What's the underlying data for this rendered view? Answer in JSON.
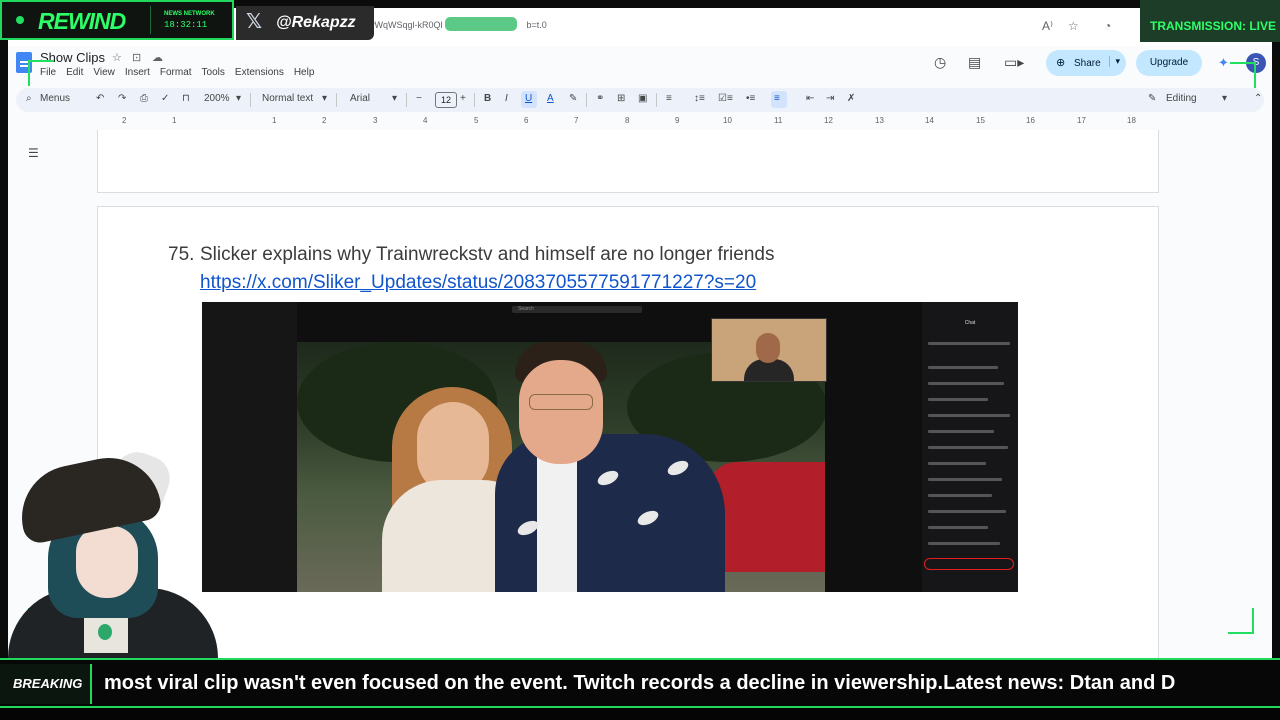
{
  "browser": {
    "url_fragment": "vWqWSqgl-kR0Ql",
    "url_suffix": "b=t.0"
  },
  "docs": {
    "title": "Show Clips",
    "menu": [
      "File",
      "Edit",
      "View",
      "Insert",
      "Format",
      "Tools",
      "Extensions",
      "Help"
    ],
    "share_label": "Share",
    "upgrade_label": "Upgrade",
    "avatar_letter": "S",
    "toolbar": {
      "menus_label": "Menus",
      "zoom": "200%",
      "style": "Normal text",
      "font": "Arial",
      "font_size": "12",
      "mode": "Editing"
    },
    "ruler_numbers": [
      "2",
      "1",
      "1",
      "2",
      "3",
      "4",
      "5",
      "6",
      "7",
      "8",
      "9",
      "10",
      "11",
      "12",
      "13",
      "14",
      "15",
      "16",
      "17",
      "18"
    ]
  },
  "document": {
    "item_number": "75.",
    "item_title": "Slicker explains why Trainwreckstv and himself are no longer friends",
    "item_link": "https://x.com/Sliker_Updates/status/2083705577591771227?s=20",
    "clip": {
      "search_label": "Search",
      "chat_header": "Chat"
    }
  },
  "overlay": {
    "rewind_label": "REWIND",
    "news_network": "NEWS NETWORK",
    "clock": "18:32:11",
    "x_handle": "@Rekapzz",
    "transmission": "TRANSMISSION: LIVE",
    "breaking_label": "BREAKING",
    "ticker": "most viral clip wasn't even focused on the event. Twitch records a decline in viewership.Latest news: Dtan and D",
    "accent_color": "#22e05f"
  }
}
